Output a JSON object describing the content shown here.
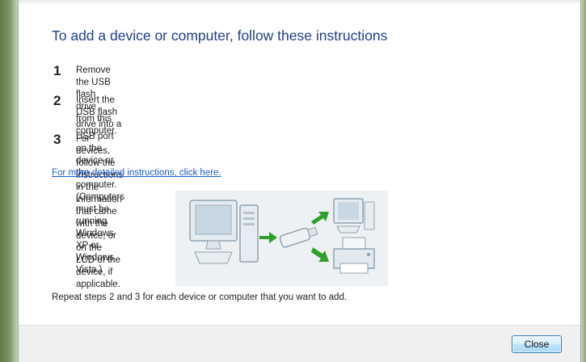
{
  "dialog": {
    "title": "To add a device or computer, follow these instructions",
    "steps": [
      {
        "number": "1",
        "text": "Remove the USB flash drive from this computer."
      },
      {
        "number": "2",
        "text": "Insert the USB flash drive into a USB port on the device or the computer. (Computers must be\nrunning Windows XP or Windows Vista.)"
      },
      {
        "number": "3",
        "text": "For devices, follow the instructions in the information that came with the device, or on the\nLCD of the device, if applicable."
      }
    ],
    "help_link": "For more detailed instructions, click here.",
    "footer_text": "Repeat steps 2 and 3 for each device or computer that you want to add.",
    "close_label": "Close"
  },
  "colors": {
    "title": "#1e3f8f",
    "link": "#1a5bd6",
    "arrow": "#2ea12b",
    "button_border": "#3c7fb1"
  },
  "illustration": {
    "icons": [
      "computer-icon",
      "usb-flash-drive-icon",
      "arrow-icon",
      "monitor-icon",
      "printer-icon"
    ]
  }
}
